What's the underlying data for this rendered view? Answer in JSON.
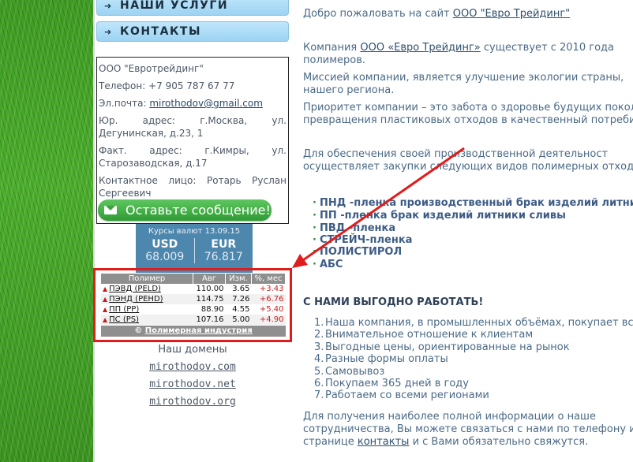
{
  "menu": {
    "services_label": "НАШИ УСЛУГИ",
    "contacts_label": "КОНТАКТЫ"
  },
  "company_info": {
    "name": "ООО \"Евротрейдинг\"",
    "phone": "Телефон: +7 905 787 67 77",
    "email_label": "Эл.почта:",
    "email": "mirothodov@gmail.com",
    "legal_address": "Юр. адрес: г.Москва, ул. Дегунинская, д.23, 1",
    "actual_address": "Факт. адрес: г.Кимры, ул. Старозаводская, д.17",
    "contact_person": "Контактное лицо: Ротарь Руслан Сергеевич"
  },
  "message_button": "Оставьте сообщение!",
  "rates": {
    "title": "Курсы валют 13.09.15",
    "usd_label": "USD",
    "usd_value": "68.009",
    "eur_label": "EUR",
    "eur_value": "76.817"
  },
  "polymer_table": {
    "headers": [
      "Полимер",
      "Авг",
      "Изм.",
      "%, мес"
    ],
    "rows": [
      {
        "name": "ПЭВД (PELD)",
        "avg": "110.00",
        "change": "3.65",
        "percent": "+3.43"
      },
      {
        "name": "ПЭНД (PEHD)",
        "avg": "114.75",
        "change": "7.26",
        "percent": "+6.76"
      },
      {
        "name": "ПП (PP)",
        "avg": "88.90",
        "change": "4.55",
        "percent": "+5.40"
      },
      {
        "name": "ПС (PS)",
        "avg": "107.16",
        "change": "5.00",
        "percent": "+4.90"
      }
    ],
    "footer_symbol": "©",
    "footer_link": "Полимерная индустрия"
  },
  "domains": {
    "title": "Наш домены",
    "items": [
      "mirothodov.com",
      "mirothodov.net",
      "mirothodov.org"
    ]
  },
  "main": {
    "welcome_prefix": "Добро пожаловать на сайт",
    "welcome_link": "ООО \"Евро Трейдинг\"",
    "p1_prefix": "Компания",
    "p1_link": "ООО «Евро Трейдинг»",
    "p1_rest": "существует с 2010 года",
    "p1_line2": "полимеров.",
    "p2_line1": "Миссией компании, является улучшение экологии страны,",
    "p2_line2": "нашего региона.",
    "p3_line1": "Приоритет компании – это забота о здоровье будущих покол",
    "p3_line2": "превращения пластиковых отходов в качественный потребит",
    "p4_line1": "Для обеспечения своей производственной деятельност",
    "p4_line2": "осуществляет закупки следующих видов полимерных отходо",
    "bullets": [
      "ПНД -пленка производственный брак изделий литни",
      "ПП -пленка брак изделий литники сливы",
      "ПВД -пленка",
      "СТРЕЙЧ-пленка",
      "ПОЛИСТИРОЛ",
      "АБС"
    ],
    "benefits_title": "С НАМИ ВЫГОДНО РАБОТАТЬ!",
    "benefits": [
      "Наша компания, в промышленных объёмах, покупает вс",
      "Внимательное отношение к клиентам",
      "Выгодные цены, ориентированные на рынок",
      "Разные формы оплаты",
      "Самовывоз",
      "Покупаем 365 дней в году",
      "Работаем со всеми регионами"
    ],
    "closing_line1": "Для получения наиболее полной информации о наше",
    "closing_line2": "сотрудничества, Вы можете связаться с нами по телефону и",
    "closing_prefix": "странице",
    "closing_link": "контакты",
    "closing_rest": "и с Вами обязательно свяжутся."
  },
  "colors": {
    "highlight_border": "#e01c1c",
    "arrow": "#e01c1c",
    "grass": "#4cae2c",
    "menu_button": "#9dd3f3",
    "message_button": "#2f9b35",
    "rates_panel": "#4e87ad"
  },
  "icons": {
    "menu_arrow": "arrow-right-icon",
    "envelope": "envelope-icon",
    "up_triangle": "triangle-up-icon"
  }
}
